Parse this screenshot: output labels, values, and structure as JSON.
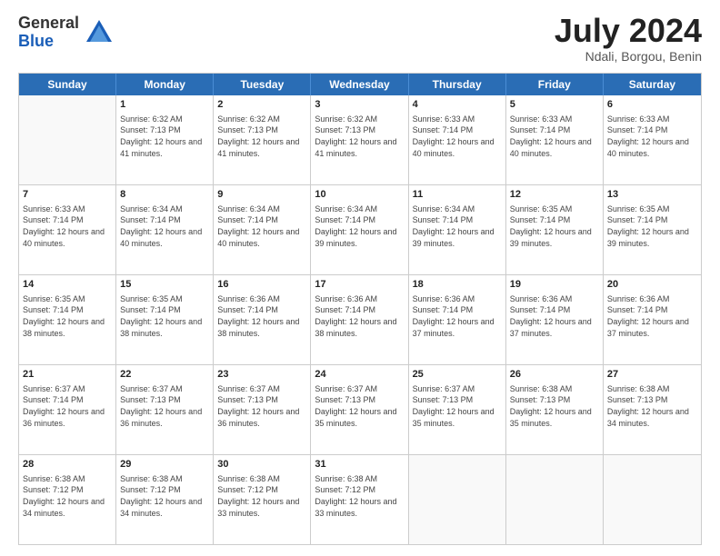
{
  "logo": {
    "general": "General",
    "blue": "Blue"
  },
  "header": {
    "month_year": "July 2024",
    "location": "Ndali, Borgou, Benin"
  },
  "days_of_week": [
    "Sunday",
    "Monday",
    "Tuesday",
    "Wednesday",
    "Thursday",
    "Friday",
    "Saturday"
  ],
  "weeks": [
    [
      {
        "day": "",
        "empty": true
      },
      {
        "day": "1",
        "sunrise": "Sunrise: 6:32 AM",
        "sunset": "Sunset: 7:13 PM",
        "daylight": "Daylight: 12 hours and 41 minutes."
      },
      {
        "day": "2",
        "sunrise": "Sunrise: 6:32 AM",
        "sunset": "Sunset: 7:13 PM",
        "daylight": "Daylight: 12 hours and 41 minutes."
      },
      {
        "day": "3",
        "sunrise": "Sunrise: 6:32 AM",
        "sunset": "Sunset: 7:13 PM",
        "daylight": "Daylight: 12 hours and 41 minutes."
      },
      {
        "day": "4",
        "sunrise": "Sunrise: 6:33 AM",
        "sunset": "Sunset: 7:14 PM",
        "daylight": "Daylight: 12 hours and 40 minutes."
      },
      {
        "day": "5",
        "sunrise": "Sunrise: 6:33 AM",
        "sunset": "Sunset: 7:14 PM",
        "daylight": "Daylight: 12 hours and 40 minutes."
      },
      {
        "day": "6",
        "sunrise": "Sunrise: 6:33 AM",
        "sunset": "Sunset: 7:14 PM",
        "daylight": "Daylight: 12 hours and 40 minutes."
      }
    ],
    [
      {
        "day": "7",
        "sunrise": "Sunrise: 6:33 AM",
        "sunset": "Sunset: 7:14 PM",
        "daylight": "Daylight: 12 hours and 40 minutes."
      },
      {
        "day": "8",
        "sunrise": "Sunrise: 6:34 AM",
        "sunset": "Sunset: 7:14 PM",
        "daylight": "Daylight: 12 hours and 40 minutes."
      },
      {
        "day": "9",
        "sunrise": "Sunrise: 6:34 AM",
        "sunset": "Sunset: 7:14 PM",
        "daylight": "Daylight: 12 hours and 40 minutes."
      },
      {
        "day": "10",
        "sunrise": "Sunrise: 6:34 AM",
        "sunset": "Sunset: 7:14 PM",
        "daylight": "Daylight: 12 hours and 39 minutes."
      },
      {
        "day": "11",
        "sunrise": "Sunrise: 6:34 AM",
        "sunset": "Sunset: 7:14 PM",
        "daylight": "Daylight: 12 hours and 39 minutes."
      },
      {
        "day": "12",
        "sunrise": "Sunrise: 6:35 AM",
        "sunset": "Sunset: 7:14 PM",
        "daylight": "Daylight: 12 hours and 39 minutes."
      },
      {
        "day": "13",
        "sunrise": "Sunrise: 6:35 AM",
        "sunset": "Sunset: 7:14 PM",
        "daylight": "Daylight: 12 hours and 39 minutes."
      }
    ],
    [
      {
        "day": "14",
        "sunrise": "Sunrise: 6:35 AM",
        "sunset": "Sunset: 7:14 PM",
        "daylight": "Daylight: 12 hours and 38 minutes."
      },
      {
        "day": "15",
        "sunrise": "Sunrise: 6:35 AM",
        "sunset": "Sunset: 7:14 PM",
        "daylight": "Daylight: 12 hours and 38 minutes."
      },
      {
        "day": "16",
        "sunrise": "Sunrise: 6:36 AM",
        "sunset": "Sunset: 7:14 PM",
        "daylight": "Daylight: 12 hours and 38 minutes."
      },
      {
        "day": "17",
        "sunrise": "Sunrise: 6:36 AM",
        "sunset": "Sunset: 7:14 PM",
        "daylight": "Daylight: 12 hours and 38 minutes."
      },
      {
        "day": "18",
        "sunrise": "Sunrise: 6:36 AM",
        "sunset": "Sunset: 7:14 PM",
        "daylight": "Daylight: 12 hours and 37 minutes."
      },
      {
        "day": "19",
        "sunrise": "Sunrise: 6:36 AM",
        "sunset": "Sunset: 7:14 PM",
        "daylight": "Daylight: 12 hours and 37 minutes."
      },
      {
        "day": "20",
        "sunrise": "Sunrise: 6:36 AM",
        "sunset": "Sunset: 7:14 PM",
        "daylight": "Daylight: 12 hours and 37 minutes."
      }
    ],
    [
      {
        "day": "21",
        "sunrise": "Sunrise: 6:37 AM",
        "sunset": "Sunset: 7:14 PM",
        "daylight": "Daylight: 12 hours and 36 minutes."
      },
      {
        "day": "22",
        "sunrise": "Sunrise: 6:37 AM",
        "sunset": "Sunset: 7:13 PM",
        "daylight": "Daylight: 12 hours and 36 minutes."
      },
      {
        "day": "23",
        "sunrise": "Sunrise: 6:37 AM",
        "sunset": "Sunset: 7:13 PM",
        "daylight": "Daylight: 12 hours and 36 minutes."
      },
      {
        "day": "24",
        "sunrise": "Sunrise: 6:37 AM",
        "sunset": "Sunset: 7:13 PM",
        "daylight": "Daylight: 12 hours and 35 minutes."
      },
      {
        "day": "25",
        "sunrise": "Sunrise: 6:37 AM",
        "sunset": "Sunset: 7:13 PM",
        "daylight": "Daylight: 12 hours and 35 minutes."
      },
      {
        "day": "26",
        "sunrise": "Sunrise: 6:38 AM",
        "sunset": "Sunset: 7:13 PM",
        "daylight": "Daylight: 12 hours and 35 minutes."
      },
      {
        "day": "27",
        "sunrise": "Sunrise: 6:38 AM",
        "sunset": "Sunset: 7:13 PM",
        "daylight": "Daylight: 12 hours and 34 minutes."
      }
    ],
    [
      {
        "day": "28",
        "sunrise": "Sunrise: 6:38 AM",
        "sunset": "Sunset: 7:12 PM",
        "daylight": "Daylight: 12 hours and 34 minutes."
      },
      {
        "day": "29",
        "sunrise": "Sunrise: 6:38 AM",
        "sunset": "Sunset: 7:12 PM",
        "daylight": "Daylight: 12 hours and 34 minutes."
      },
      {
        "day": "30",
        "sunrise": "Sunrise: 6:38 AM",
        "sunset": "Sunset: 7:12 PM",
        "daylight": "Daylight: 12 hours and 33 minutes."
      },
      {
        "day": "31",
        "sunrise": "Sunrise: 6:38 AM",
        "sunset": "Sunset: 7:12 PM",
        "daylight": "Daylight: 12 hours and 33 minutes."
      },
      {
        "day": "",
        "empty": true
      },
      {
        "day": "",
        "empty": true
      },
      {
        "day": "",
        "empty": true
      }
    ]
  ]
}
